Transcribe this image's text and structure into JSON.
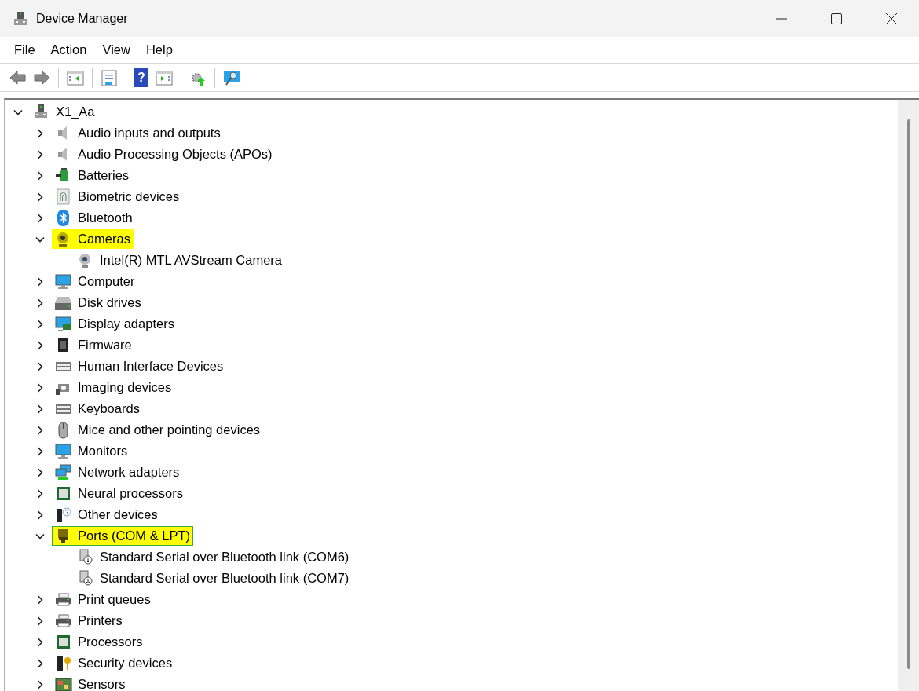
{
  "window": {
    "title": "Device Manager"
  },
  "menu": [
    "File",
    "Action",
    "View",
    "Help"
  ],
  "toolbar": [
    {
      "kind": "back"
    },
    {
      "kind": "forward"
    },
    {
      "kind": "sep"
    },
    {
      "kind": "console-tree"
    },
    {
      "kind": "sep"
    },
    {
      "kind": "properties"
    },
    {
      "kind": "sep"
    },
    {
      "kind": "help",
      "label": "?"
    },
    {
      "kind": "action-pane"
    },
    {
      "kind": "sep"
    },
    {
      "kind": "update-driver"
    },
    {
      "kind": "sep"
    },
    {
      "kind": "scan"
    }
  ],
  "tree": [
    {
      "label": "X1_Aa",
      "expanded": true,
      "highlighted": false,
      "selected": false,
      "children": [
        {
          "label": "Audio inputs and outputs",
          "expanded": false,
          "highlighted": false,
          "selected": false
        },
        {
          "label": "Audio Processing Objects (APOs)",
          "expanded": false,
          "highlighted": false,
          "selected": false
        },
        {
          "label": "Batteries",
          "expanded": false,
          "highlighted": false,
          "selected": false
        },
        {
          "label": "Biometric devices",
          "expanded": false,
          "highlighted": false,
          "selected": false
        },
        {
          "label": "Bluetooth",
          "expanded": false,
          "highlighted": false,
          "selected": false
        },
        {
          "label": "Cameras",
          "expanded": true,
          "highlighted": true,
          "selected": false,
          "children": [
            {
              "label": "Intel(R) MTL AVStream Camera"
            }
          ]
        },
        {
          "label": "Computer",
          "expanded": false,
          "highlighted": false,
          "selected": false
        },
        {
          "label": "Disk drives",
          "expanded": false,
          "highlighted": false,
          "selected": false
        },
        {
          "label": "Display adapters",
          "expanded": false,
          "highlighted": false,
          "selected": false
        },
        {
          "label": "Firmware",
          "expanded": false,
          "highlighted": false,
          "selected": false
        },
        {
          "label": "Human Interface Devices",
          "expanded": false,
          "highlighted": false,
          "selected": false
        },
        {
          "label": "Imaging devices",
          "expanded": false,
          "highlighted": false,
          "selected": false
        },
        {
          "label": "Keyboards",
          "expanded": false,
          "highlighted": false,
          "selected": false
        },
        {
          "label": "Mice and other pointing devices",
          "expanded": false,
          "highlighted": false,
          "selected": false
        },
        {
          "label": "Monitors",
          "expanded": false,
          "highlighted": false,
          "selected": false
        },
        {
          "label": "Network adapters",
          "expanded": false,
          "highlighted": false,
          "selected": false
        },
        {
          "label": "Neural processors",
          "expanded": false,
          "highlighted": false,
          "selected": false
        },
        {
          "label": "Other devices",
          "expanded": false,
          "highlighted": false,
          "selected": false
        },
        {
          "label": "Ports (COM & LPT)",
          "expanded": true,
          "highlighted": true,
          "selected": true,
          "children": [
            {
              "label": "Standard Serial over Bluetooth link (COM6)"
            },
            {
              "label": "Standard Serial over Bluetooth link (COM7)"
            }
          ]
        },
        {
          "label": "Print queues",
          "expanded": false,
          "highlighted": false,
          "selected": false
        },
        {
          "label": "Printers",
          "expanded": false,
          "highlighted": false,
          "selected": false
        },
        {
          "label": "Processors",
          "expanded": false,
          "highlighted": false,
          "selected": false
        },
        {
          "label": "Security devices",
          "expanded": false,
          "highlighted": false,
          "selected": false
        },
        {
          "label": "Sensors",
          "expanded": false,
          "highlighted": false,
          "selected": false
        }
      ]
    }
  ]
}
